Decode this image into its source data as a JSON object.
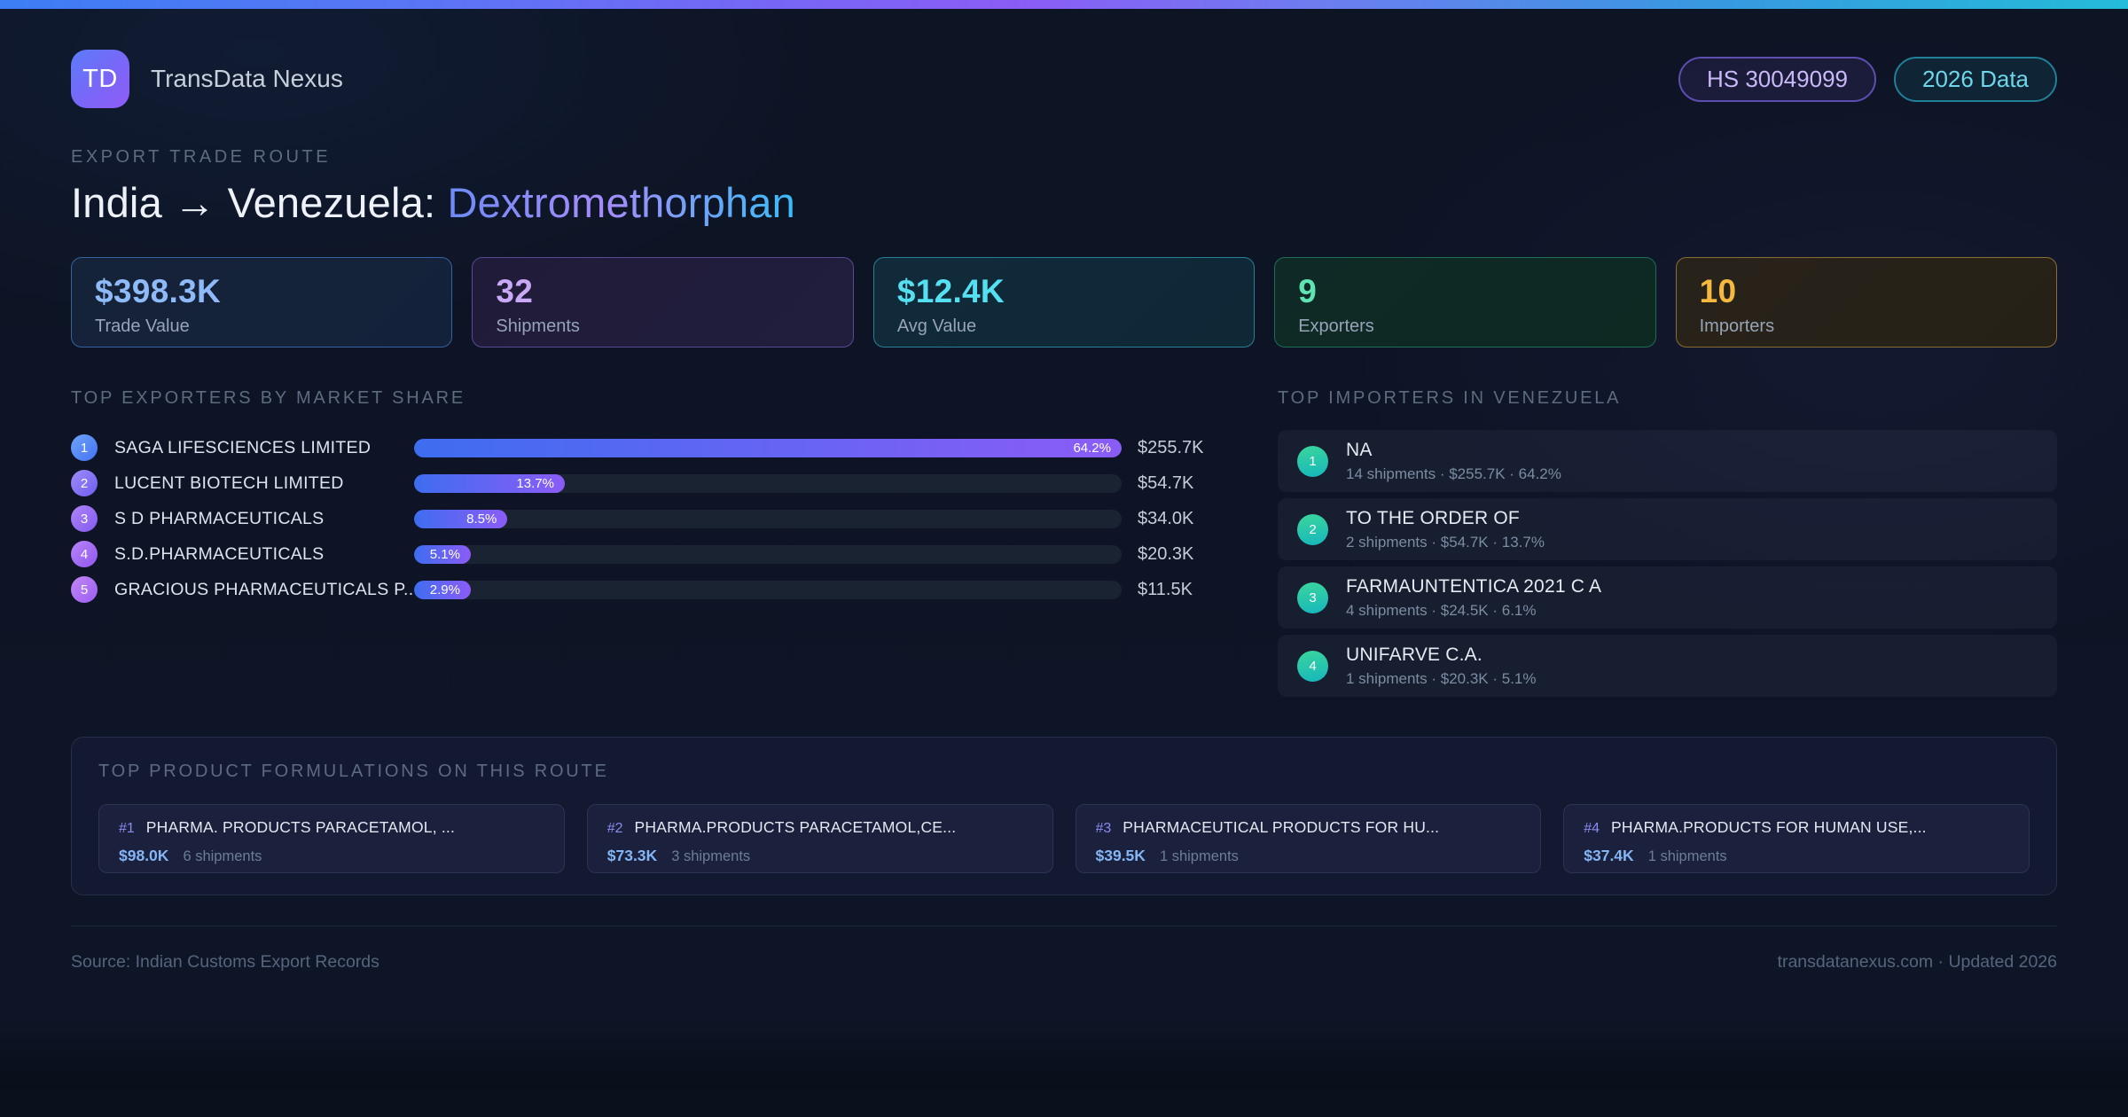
{
  "brand": {
    "logo": "TD",
    "name": "TransData Nexus"
  },
  "badges": {
    "hs_code": "HS 30049099",
    "year": "2026 Data"
  },
  "header_block": {
    "eyebrow": "EXPORT TRADE ROUTE",
    "title_route": "India → Venezuela:",
    "title_product": "Dextromethorphan"
  },
  "stats": [
    {
      "value": "$398.3K",
      "label": "Trade Value"
    },
    {
      "value": "32",
      "label": "Shipments"
    },
    {
      "value": "$12.4K",
      "label": "Avg Value"
    },
    {
      "value": "9",
      "label": "Exporters"
    },
    {
      "value": "10",
      "label": "Importers"
    }
  ],
  "exporters": {
    "heading": "TOP EXPORTERS BY MARKET SHARE",
    "items": [
      {
        "rank": "1",
        "name": "SAGA LIFESCIENCES LIMITED",
        "share": "64.2%",
        "fill_pct": 100,
        "value": "$255.7K"
      },
      {
        "rank": "2",
        "name": "LUCENT BIOTECH LIMITED",
        "share": "13.7%",
        "fill_pct": 21.3,
        "value": "$54.7K"
      },
      {
        "rank": "3",
        "name": "S D PHARMACEUTICALS",
        "share": "8.5%",
        "fill_pct": 13.2,
        "value": "$34.0K"
      },
      {
        "rank": "4",
        "name": "S.D.PHARMACEUTICALS",
        "share": "5.1%",
        "fill_pct": 7.9,
        "value": "$20.3K"
      },
      {
        "rank": "5",
        "name": "GRACIOUS PHARMACEUTICALS P...",
        "share": "2.9%",
        "fill_pct": 4.5,
        "value": "$11.5K"
      }
    ]
  },
  "importers": {
    "heading": "TOP IMPORTERS IN VENEZUELA",
    "items": [
      {
        "rank": "1",
        "name": "NA",
        "meta": "14 shipments · $255.7K · 64.2%"
      },
      {
        "rank": "2",
        "name": "TO THE ORDER OF",
        "meta": "2 shipments · $54.7K · 13.7%"
      },
      {
        "rank": "3",
        "name": "FARMAUNTENTICA 2021 C A",
        "meta": "4 shipments · $24.5K · 6.1%"
      },
      {
        "rank": "4",
        "name": "UNIFARVE C.A.",
        "meta": "1 shipments · $20.3K · 5.1%"
      }
    ]
  },
  "products": {
    "heading": "TOP PRODUCT FORMULATIONS ON THIS ROUTE",
    "items": [
      {
        "rank": "#1",
        "name": "PHARMA. PRODUCTS PARACETAMOL, ...",
        "value": "$98.0K",
        "shipments": "6 shipments"
      },
      {
        "rank": "#2",
        "name": "PHARMA.PRODUCTS PARACETAMOL,CE...",
        "value": "$73.3K",
        "shipments": "3 shipments"
      },
      {
        "rank": "#3",
        "name": "PHARMACEUTICAL PRODUCTS FOR HU...",
        "value": "$39.5K",
        "shipments": "1 shipments"
      },
      {
        "rank": "#4",
        "name": "PHARMA.PRODUCTS FOR HUMAN USE,...",
        "value": "$37.4K",
        "shipments": "1 shipments"
      }
    ]
  },
  "footer": {
    "source": "Source: Indian Customs Export Records",
    "site": "transdatanexus.com · Updated 2026"
  },
  "colors": {
    "accent_blue": "#3d7ef5",
    "accent_purple": "#8b5cf6",
    "accent_cyan": "#24bcd9",
    "stat_blue": "#8fbaf8",
    "stat_purple": "#c9a9f6",
    "stat_teal": "#55e0f2",
    "stat_green": "#5fe3b2",
    "stat_amber": "#f5b93d",
    "importer_badge_green": "#3bd69c",
    "background": "#0d1424"
  },
  "chart_data": {
    "type": "bar",
    "title": "TOP EXPORTERS BY MARKET SHARE",
    "categories": [
      "SAGA LIFESCIENCES LIMITED",
      "LUCENT BIOTECH LIMITED",
      "S D PHARMACEUTICALS",
      "S.D.PHARMACEUTICALS",
      "GRACIOUS PHARMACEUTICALS P..."
    ],
    "values": [
      64.2,
      13.7,
      8.5,
      5.1,
      2.9
    ],
    "values_usd": [
      "$255.7K",
      "$54.7K",
      "$34.0K",
      "$20.3K",
      "$11.5K"
    ],
    "xlabel": "Market share (%)",
    "ylabel": "",
    "xlim": [
      0,
      64.2
    ],
    "orientation": "horizontal",
    "grid": false,
    "legend": false
  }
}
